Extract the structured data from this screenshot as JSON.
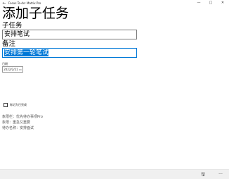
{
  "window": {
    "title": "Focus To-do: Matrix Pro",
    "back_glyph": "←",
    "minimize_glyph": "—",
    "maximize_glyph": "□",
    "close_glyph": "✕"
  },
  "page": {
    "title": "添加子任务"
  },
  "form": {
    "subtask_label": "子任务",
    "subtask_value": "安排笔试",
    "note_label": "备注",
    "note_value": "安排第一轮笔试",
    "date_label": "日期",
    "date_value": "2022/2/21",
    "date_suffix": "▭",
    "complete_label": "标记为已完成"
  },
  "info": {
    "quadrant": "象限栏：优先待办事项Pro",
    "category": "象限：重急又重要",
    "parent_task": "待办名称：安排面试"
  },
  "bottom_bar": {
    "save_glyph": "🖫",
    "more_glyph": "···"
  }
}
